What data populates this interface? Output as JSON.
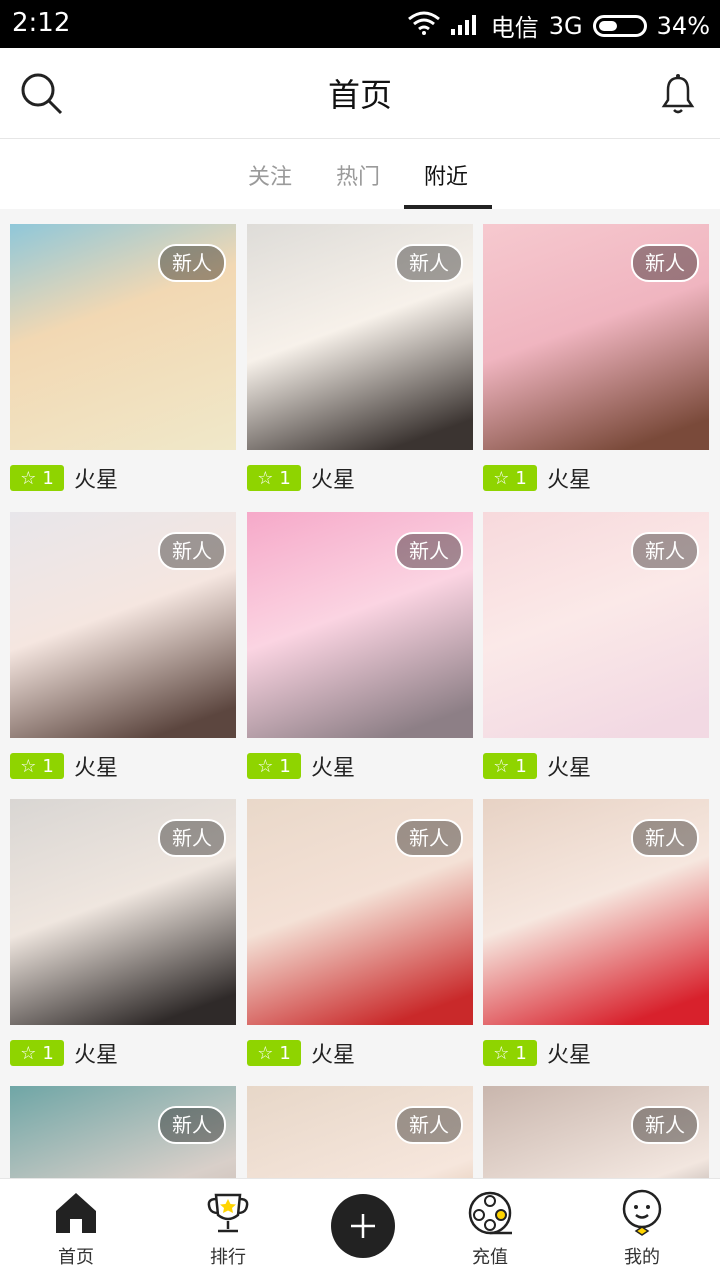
{
  "status": {
    "time": "2:12",
    "carrier": "电信",
    "network": "3G",
    "battery": "34%"
  },
  "header": {
    "title": "首页"
  },
  "tabs": [
    {
      "label": "关注"
    },
    {
      "label": "热门"
    },
    {
      "label": "附近"
    }
  ],
  "grid": {
    "items": [
      {
        "badge": "新人",
        "level": "1",
        "name": "火星"
      },
      {
        "badge": "新人",
        "level": "1",
        "name": "火星"
      },
      {
        "badge": "新人",
        "level": "1",
        "name": "火星"
      },
      {
        "badge": "新人",
        "level": "1",
        "name": "火星"
      },
      {
        "badge": "新人",
        "level": "1",
        "name": "火星"
      },
      {
        "badge": "新人",
        "level": "1",
        "name": "火星"
      },
      {
        "badge": "新人",
        "level": "1",
        "name": "火星"
      },
      {
        "badge": "新人",
        "level": "1",
        "name": "火星"
      },
      {
        "badge": "新人",
        "level": "1",
        "name": "火星"
      },
      {
        "badge": "新人"
      },
      {
        "badge": "新人"
      },
      {
        "badge": "新人"
      }
    ]
  },
  "bottom_nav": [
    {
      "label": "首页",
      "icon": "home-icon"
    },
    {
      "label": "排行",
      "icon": "trophy-icon"
    },
    {
      "label": "",
      "icon": "plus-icon"
    },
    {
      "label": "充值",
      "icon": "film-reel-icon"
    },
    {
      "label": "我的",
      "icon": "profile-icon"
    }
  ],
  "colors": {
    "accent": "#8fd400",
    "dark": "#222222"
  }
}
